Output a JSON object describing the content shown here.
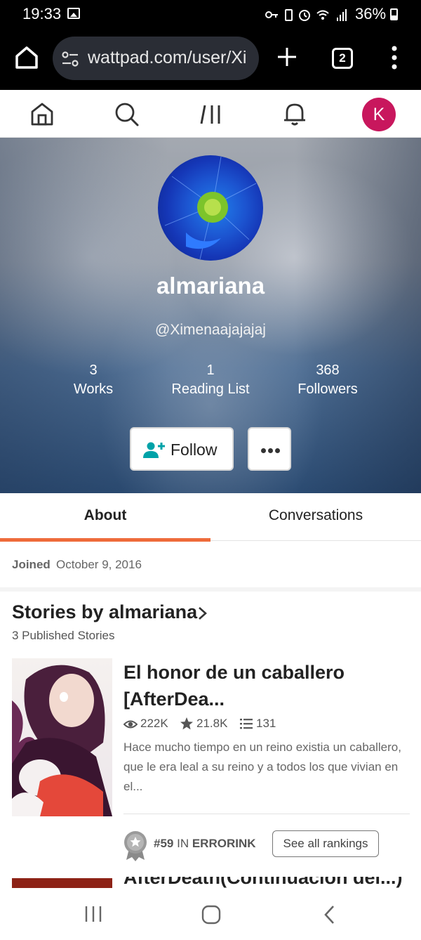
{
  "status_bar": {
    "time": "19:33",
    "battery": "36%",
    "icons": [
      "gallery-icon",
      "key-icon",
      "battery-saver-icon",
      "alarm-icon",
      "wifi-icon",
      "signal-icon"
    ]
  },
  "browser": {
    "url": "wattpad.com/user/Xi",
    "tab_count": "2"
  },
  "nav": {
    "avatar_initial": "K",
    "avatar_color": "#c8175d"
  },
  "profile": {
    "display_name": "almariana",
    "handle": "@Ximenaajajajaj",
    "stats": [
      {
        "value": "3",
        "label": "Works"
      },
      {
        "value": "1",
        "label": "Reading List"
      },
      {
        "value": "368",
        "label": "Followers"
      }
    ],
    "follow_label": "Follow"
  },
  "tabs": [
    {
      "label": "About",
      "active": true
    },
    {
      "label": "Conversations",
      "active": false
    }
  ],
  "about": {
    "joined_label": "Joined",
    "joined_date": "October 9, 2016"
  },
  "stories": {
    "title": "Stories by almariana",
    "subtitle": "3 Published Stories",
    "items": [
      {
        "title": "El honor de un caballero [AfterDea...",
        "reads": "222K",
        "votes": "21.8K",
        "parts": "131",
        "description": "Hace mucho tiempo en un reino existia un caballero, que le era leal a su reino y a todos los que vivian en el...",
        "rank_number": "#59",
        "rank_in": "IN",
        "rank_tag": "ERRORINK",
        "rankings_button": "See all rankings"
      },
      {
        "title": "AfterDeath(Continuacion del...)"
      }
    ]
  },
  "colors": {
    "accent_orange": "#ee6b3a",
    "follow_teal": "#00a2a8"
  }
}
